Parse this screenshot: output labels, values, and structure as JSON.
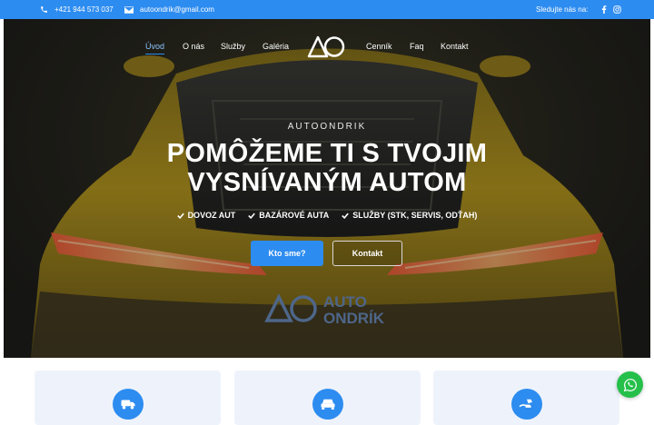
{
  "topbar": {
    "phone": "+421 944 573 037",
    "email": "autoondrik@gmail.com",
    "follow_label": "Sledujte nás na:",
    "social": [
      "facebook-icon",
      "instagram-icon"
    ]
  },
  "nav": {
    "items": [
      "Úvod",
      "O nás",
      "Služby",
      "Galéria",
      "Cenník",
      "Faq",
      "Kontakt"
    ],
    "active": "Úvod"
  },
  "hero": {
    "kicker": "AUTOONDRIK",
    "headline_line1": "POMÔŽEME TI S TVOJIM",
    "headline_line2": "VYSNÍVANÝM AUTOM",
    "checks": [
      "DOVOZ AUT",
      "BAZÁROVÉ AUTA",
      "SLUŽBY (STK, SERVIS, ODŤAH)"
    ],
    "plate_text_1": "AUTO",
    "plate_text_2": "ONDRÍK",
    "button_primary": "Kto sme?",
    "button_secondary": "Kontakt"
  },
  "cards": {
    "icons": [
      "car-import-icon",
      "car-front-icon",
      "service-hand-icon"
    ]
  },
  "colors": {
    "accent": "#2d8cf0",
    "car_yellow": "#c9a21a",
    "whatsapp": "#25c04a"
  }
}
